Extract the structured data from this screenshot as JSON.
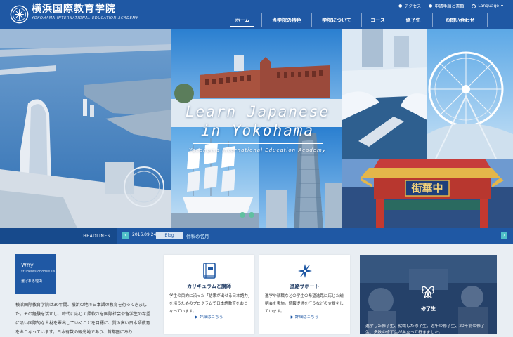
{
  "header": {
    "brand_jp": "横浜国際教育学院",
    "brand_en": "YOKOHAMA INTERNATIONAL EDUCATION ACADEMY",
    "utility": [
      {
        "label": "アクセス",
        "icon": "location-icon"
      },
      {
        "label": "申請手順と書類",
        "icon": "document-icon"
      },
      {
        "label": "Language",
        "icon": "globe-icon"
      }
    ],
    "nav": [
      {
        "label": "ホーム",
        "active": true
      },
      {
        "label": "当学院の特色",
        "active": false
      },
      {
        "label": "学院について",
        "active": false
      },
      {
        "label": "コース",
        "active": false
      },
      {
        "label": "修了生",
        "active": false
      },
      {
        "label": "お問い合わせ",
        "active": false
      }
    ]
  },
  "hero": {
    "line1": "Learn Japanese",
    "line2": "in Yokohama",
    "subtitle": "Yokohama International Education Academy",
    "gate_sign": "街華中"
  },
  "headlines": {
    "label": "HEADLINES",
    "date": "2016.09.24",
    "tag": "Blog",
    "title": "仲秋の名月",
    "prev_icon": "chevron-left-icon",
    "next_icon": "chevron-right-icon"
  },
  "why": {
    "title": "Why",
    "subtitle": "students choose us",
    "link": "選ばれる理由"
  },
  "intro": {
    "text": "横浜国際教育学院は30年間、横浜の地で日本語の教育を行ってきました。その経験を活かし、時代に応じて柔軟さを国際社会や留学生の希望に沿い国際的な人材を輩出していくことを目標に、質の高い日本語教育をおこなっています。日本有数の観光地であり、首都圏にあり"
  },
  "cards": [
    {
      "icon": "book-icon",
      "title": "カリキュラムと講師",
      "text": "学生の目的に沿った「結果が出せる日本語力」を培うためのプログラムで日本語教育をおこなっています。",
      "link": "▶ 詳細はこちら"
    },
    {
      "icon": "compass-icon",
      "title": "進路サポート",
      "text": "進学や就職などの学生の希望進路に応じた説明会を実施。情報提供を行うなどの支援をしています。",
      "link": "▶ 詳細はこちら"
    }
  ],
  "graduate": {
    "icon": "ribbon-icon",
    "title": "修了生",
    "text": "進学した修了生、就職した修了生、近年の修了生、20年前の修了生、多数の修了生が巣立って行きました。"
  }
}
